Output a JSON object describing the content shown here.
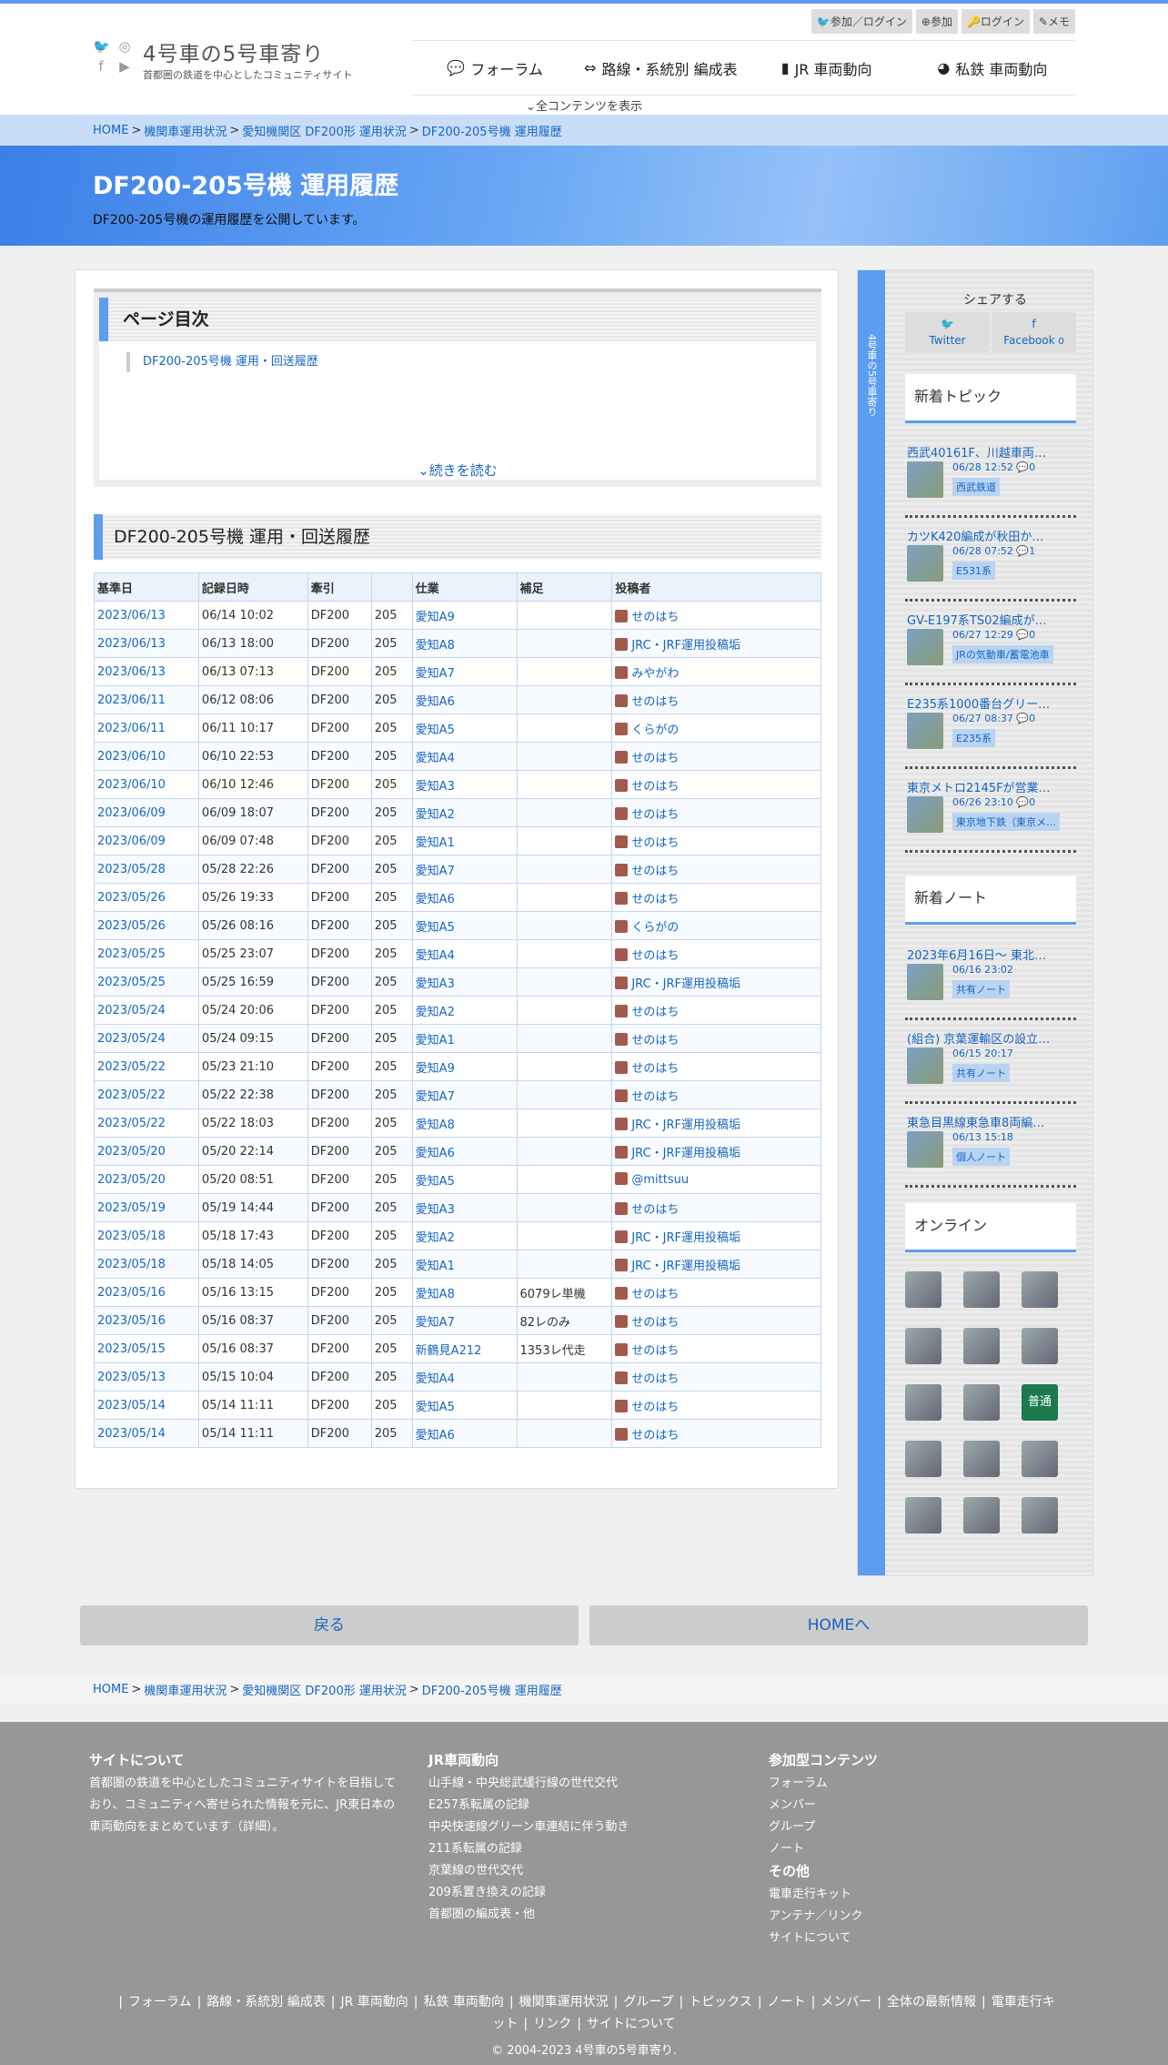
{
  "site": {
    "title": "4号車の5号車寄り",
    "subtitle": "首都圏の鉄道を中心としたコミュニティサイト"
  },
  "user_menu": [
    "参加／ログイン",
    "参加",
    "ログイン",
    "メモ"
  ],
  "gnav": [
    "フォーラム",
    "路線・系統別 編成表",
    "JR 車両動向",
    "私鉄 車両動向"
  ],
  "all_contents": "全コンテンツを表示",
  "breadcrumb": [
    "HOME",
    "機関車運用状況",
    "愛知機関区 DF200形 運用状況",
    "DF200-205号機 運用履歴"
  ],
  "page": {
    "title": "DF200-205号機 運用履歴",
    "lead": "DF200-205号機の運用履歴を公開しています。"
  },
  "toc": {
    "title": "ページ目次",
    "item": "DF200-205号機 運用・回送履歴",
    "more": "続きを読む"
  },
  "section_title": "DF200-205号機 運用・回送履歴",
  "table": {
    "headers": [
      "基準日",
      "記録日時",
      "牽引",
      "",
      "仕業",
      "補足",
      "投稿者"
    ],
    "rows": [
      [
        "2023/06/13",
        "06/14 10:02",
        "DF200",
        "205",
        "愛知A9",
        "",
        "せのはち"
      ],
      [
        "2023/06/13",
        "06/13 18:00",
        "DF200",
        "205",
        "愛知A8",
        "",
        "JRC・JRF運用投稿垢"
      ],
      [
        "2023/06/13",
        "06/13 07:13",
        "DF200",
        "205",
        "愛知A7",
        "",
        "みやがわ"
      ],
      [
        "2023/06/11",
        "06/12 08:06",
        "DF200",
        "205",
        "愛知A6",
        "",
        "せのはち"
      ],
      [
        "2023/06/11",
        "06/11 10:17",
        "DF200",
        "205",
        "愛知A5",
        "",
        "くらがの"
      ],
      [
        "2023/06/10",
        "06/10 22:53",
        "DF200",
        "205",
        "愛知A4",
        "",
        "せのはち"
      ],
      [
        "2023/06/10",
        "06/10 12:46",
        "DF200",
        "205",
        "愛知A3",
        "",
        "せのはち"
      ],
      [
        "2023/06/09",
        "06/09 18:07",
        "DF200",
        "205",
        "愛知A2",
        "",
        "せのはち"
      ],
      [
        "2023/06/09",
        "06/09 07:48",
        "DF200",
        "205",
        "愛知A1",
        "",
        "せのはち"
      ],
      [
        "2023/05/28",
        "05/28 22:26",
        "DF200",
        "205",
        "愛知A7",
        "",
        "せのはち"
      ],
      [
        "2023/05/26",
        "05/26 19:33",
        "DF200",
        "205",
        "愛知A6",
        "",
        "せのはち"
      ],
      [
        "2023/05/26",
        "05/26 08:16",
        "DF200",
        "205",
        "愛知A5",
        "",
        "くらがの"
      ],
      [
        "2023/05/25",
        "05/25 23:07",
        "DF200",
        "205",
        "愛知A4",
        "",
        "せのはち"
      ],
      [
        "2023/05/25",
        "05/25 16:59",
        "DF200",
        "205",
        "愛知A3",
        "",
        "JRC・JRF運用投稿垢"
      ],
      [
        "2023/05/24",
        "05/24 20:06",
        "DF200",
        "205",
        "愛知A2",
        "",
        "せのはち"
      ],
      [
        "2023/05/24",
        "05/24 09:15",
        "DF200",
        "205",
        "愛知A1",
        "",
        "せのはち"
      ],
      [
        "2023/05/22",
        "05/23 21:10",
        "DF200",
        "205",
        "愛知A9",
        "",
        "せのはち"
      ],
      [
        "2023/05/22",
        "05/22 22:38",
        "DF200",
        "205",
        "愛知A7",
        "",
        "せのはち"
      ],
      [
        "2023/05/22",
        "05/22 18:03",
        "DF200",
        "205",
        "愛知A8",
        "",
        "JRC・JRF運用投稿垢"
      ],
      [
        "2023/05/20",
        "05/20 22:14",
        "DF200",
        "205",
        "愛知A6",
        "",
        "JRC・JRF運用投稿垢"
      ],
      [
        "2023/05/20",
        "05/20 08:51",
        "DF200",
        "205",
        "愛知A5",
        "",
        "@mittsuu"
      ],
      [
        "2023/05/19",
        "05/19 14:44",
        "DF200",
        "205",
        "愛知A3",
        "",
        "せのはち"
      ],
      [
        "2023/05/18",
        "05/18 17:43",
        "DF200",
        "205",
        "愛知A2",
        "",
        "JRC・JRF運用投稿垢"
      ],
      [
        "2023/05/18",
        "05/18 14:05",
        "DF200",
        "205",
        "愛知A1",
        "",
        "JRC・JRF運用投稿垢"
      ],
      [
        "2023/05/16",
        "05/16 13:15",
        "DF200",
        "205",
        "愛知A8",
        "6079レ単機",
        "せのはち"
      ],
      [
        "2023/05/16",
        "05/16 08:37",
        "DF200",
        "205",
        "愛知A7",
        "82レのみ",
        "せのはち"
      ],
      [
        "2023/05/15",
        "05/16 08:37",
        "DF200",
        "205",
        "新鶴見A212",
        "1353レ代走",
        "せのはち"
      ],
      [
        "2023/05/13",
        "05/15 10:04",
        "DF200",
        "205",
        "愛知A4",
        "",
        "せのはち"
      ],
      [
        "2023/05/14",
        "05/14 11:11",
        "DF200",
        "205",
        "愛知A5",
        "",
        "せのはち"
      ],
      [
        "2023/05/14",
        "05/14 11:11",
        "DF200",
        "205",
        "愛知A6",
        "",
        "せのはち"
      ]
    ]
  },
  "sidebar": {
    "vertical": "4号車の5号車寄り",
    "share_title": "シェアする",
    "share": [
      {
        "label": "Twitter"
      },
      {
        "label": "Facebook",
        "count": "0"
      }
    ],
    "new_topics_title": "新着トピック",
    "topics": [
      {
        "title": "西武40161F、川越車両…",
        "meta": "06/28 12:52",
        "comments": "0",
        "tag": "西武鉄道"
      },
      {
        "title": "カツK420編成が秋田か…",
        "meta": "06/28 07:52",
        "comments": "1",
        "tag": "E531系"
      },
      {
        "title": "GV-E197系TS02編成が…",
        "meta": "06/27 12:29",
        "comments": "0",
        "tag": "JRの気動車/蓄電池車"
      },
      {
        "title": "E235系1000番台グリー…",
        "meta": "06/27 08:37",
        "comments": "0",
        "tag": "E235系"
      },
      {
        "title": "東京メトロ2145Fが営業…",
        "meta": "06/26 23:10",
        "comments": "0",
        "tag": "東京地下鉄（東京メ…"
      }
    ],
    "new_notes_title": "新着ノート",
    "notes": [
      {
        "title": "2023年6月16日〜 東北…",
        "meta": "06/16 23:02",
        "tag": "共有ノート"
      },
      {
        "title": "(組合) 京葉運輸区の設立…",
        "meta": "06/15 20:17",
        "tag": "共有ノート"
      },
      {
        "title": "東急目黒線東急車8両編…",
        "meta": "06/13 15:18",
        "tag": "個人ノート"
      }
    ],
    "online_title": "オンライン",
    "online_label": "普通"
  },
  "buttons": {
    "back": "戻る",
    "home": "HOMEへ"
  },
  "footer": {
    "about_title": "サイトについて",
    "about_text": "首都圏の鉄道を中心としたコミュニティサイトを目指しており、コミュニティへ寄せられた情報を元に、JR東日本の車両動向をまとめています（詳細）。",
    "jr_title": "JR車両動向",
    "jr_links": [
      "山手線・中央総武緩行線の世代交代",
      "E257系転属の記録",
      "中央快速線グリーン車連結に伴う動き",
      "211系転属の記録",
      "京葉線の世代交代",
      "209系置き換えの記録",
      "首都圏の編成表・他"
    ],
    "join_title": "参加型コンテンツ",
    "join_links": [
      "フォーラム",
      "メンバー",
      "グループ",
      "ノート"
    ],
    "other_title": "その他",
    "other_links": [
      "電車走行キット",
      "アンテナ／リンク",
      "サイトについて"
    ],
    "nav": [
      "フォーラム",
      "路線・系統別 編成表",
      "JR 車両動向",
      "私鉄 車両動向",
      "機関車運用状況",
      "グループ",
      "トピックス",
      "ノート",
      "メンバー",
      "全体の最新情報",
      "電車走行キット",
      "リンク",
      "サイトについて"
    ],
    "copyright": "© 2004-2023 4号車の5号車寄り."
  },
  "colors": {
    "accent": "#5c9df0",
    "link": "#1565c0",
    "footer": "#979797"
  }
}
